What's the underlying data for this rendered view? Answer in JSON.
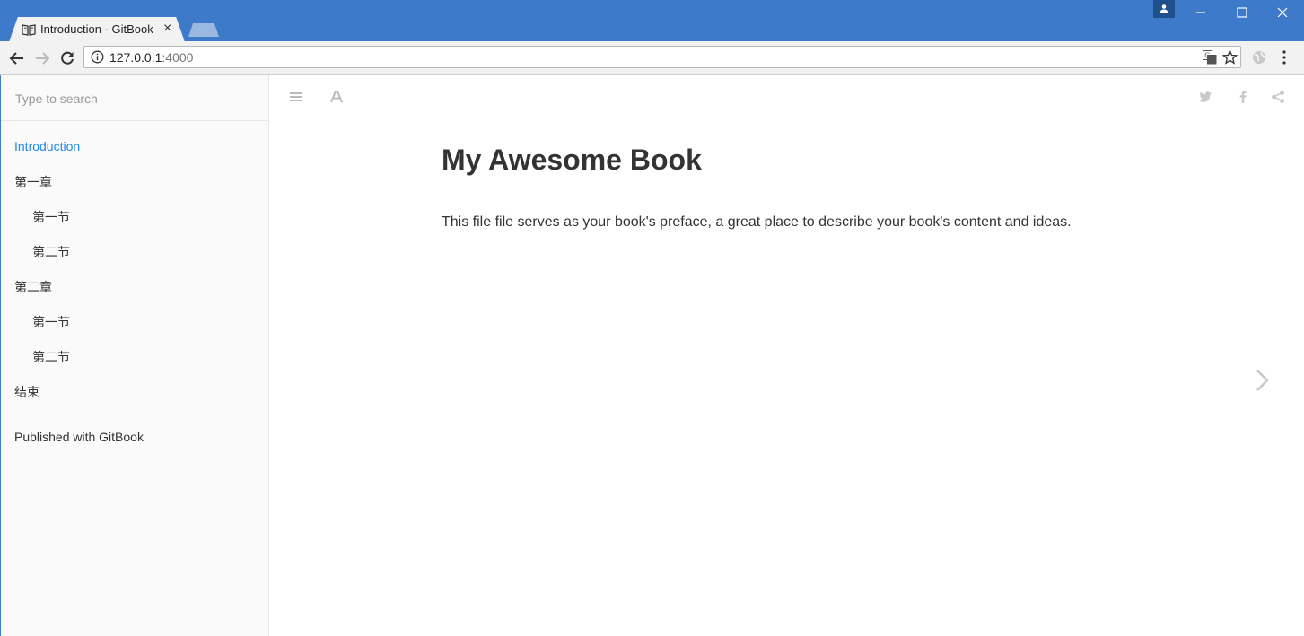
{
  "browser": {
    "tab_title": "Introduction · GitBook",
    "tab_close": "×",
    "url_host": "127.0.0.1",
    "url_port": ":4000"
  },
  "sidebar": {
    "search_placeholder": "Type to search",
    "items": [
      {
        "label": "Introduction",
        "level": 1,
        "active": true
      },
      {
        "label": "第一章",
        "level": 1,
        "active": false
      },
      {
        "label": "第一节",
        "level": 2,
        "active": false
      },
      {
        "label": "第二节",
        "level": 2,
        "active": false
      },
      {
        "label": "第二章",
        "level": 1,
        "active": false
      },
      {
        "label": "第一节",
        "level": 2,
        "active": false
      },
      {
        "label": "第二节",
        "level": 2,
        "active": false
      },
      {
        "label": "结束",
        "level": 1,
        "active": false
      }
    ],
    "published": "Published with GitBook"
  },
  "page": {
    "title": "My Awesome Book",
    "text": "This file file serves as your book's preface, a great place to describe your book's content and ideas."
  },
  "colors": {
    "titlebar": "#3d7bca",
    "active_link": "#1e88e5",
    "icon_gray": "#c8c8c8"
  }
}
